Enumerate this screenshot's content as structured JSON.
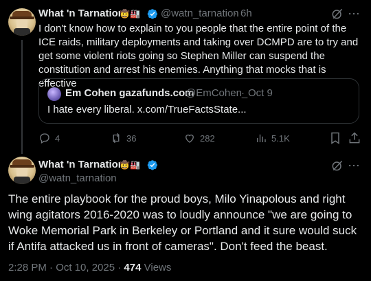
{
  "tweet1": {
    "author_name": "What 'n Tarnation",
    "emoji": "🤠🏭",
    "handle": "@watn_tarnation",
    "separator": "·",
    "time": "6h",
    "text": "I don't know how to explain to you people that the entire point of the ICE raids, military deployments and taking over DCMPD are to try and get some violent riots going so Stephen Miller can suspend the constitution and arrest his enemies. Anything that mocks that is effective",
    "quote": {
      "author_name": "Em Cohen gazafunds.com",
      "handle": "@EmCohen_",
      "separator": "·",
      "time": "Oct 9",
      "text": "I hate every liberal. x.com/TrueFactsState..."
    },
    "actions": {
      "replies": "4",
      "reposts": "36",
      "likes": "282",
      "views": "5.1K"
    }
  },
  "tweet2": {
    "author_name": "What 'n Tarnation",
    "emoji": "🤠🏭",
    "handle": "@watn_tarnation",
    "text": "The entire playbook for the proud boys, Milo Yinapolous and right wing agitators 2016-2020 was to loudly announce \"we are going to Woke Memorial Park in Berkeley or Portland and it sure would suck if Antifa attacked us in front of cameras\". Don't feed the beast.",
    "timestamp": "2:28 PM · Oct 10, 2025 ·",
    "views_count": "474",
    "views_label": "Views"
  },
  "colors": {
    "background": "#000000",
    "text": "#e7e9ea",
    "muted": "#71767b",
    "verified": "#1d9bf0",
    "border": "#2f3336"
  }
}
